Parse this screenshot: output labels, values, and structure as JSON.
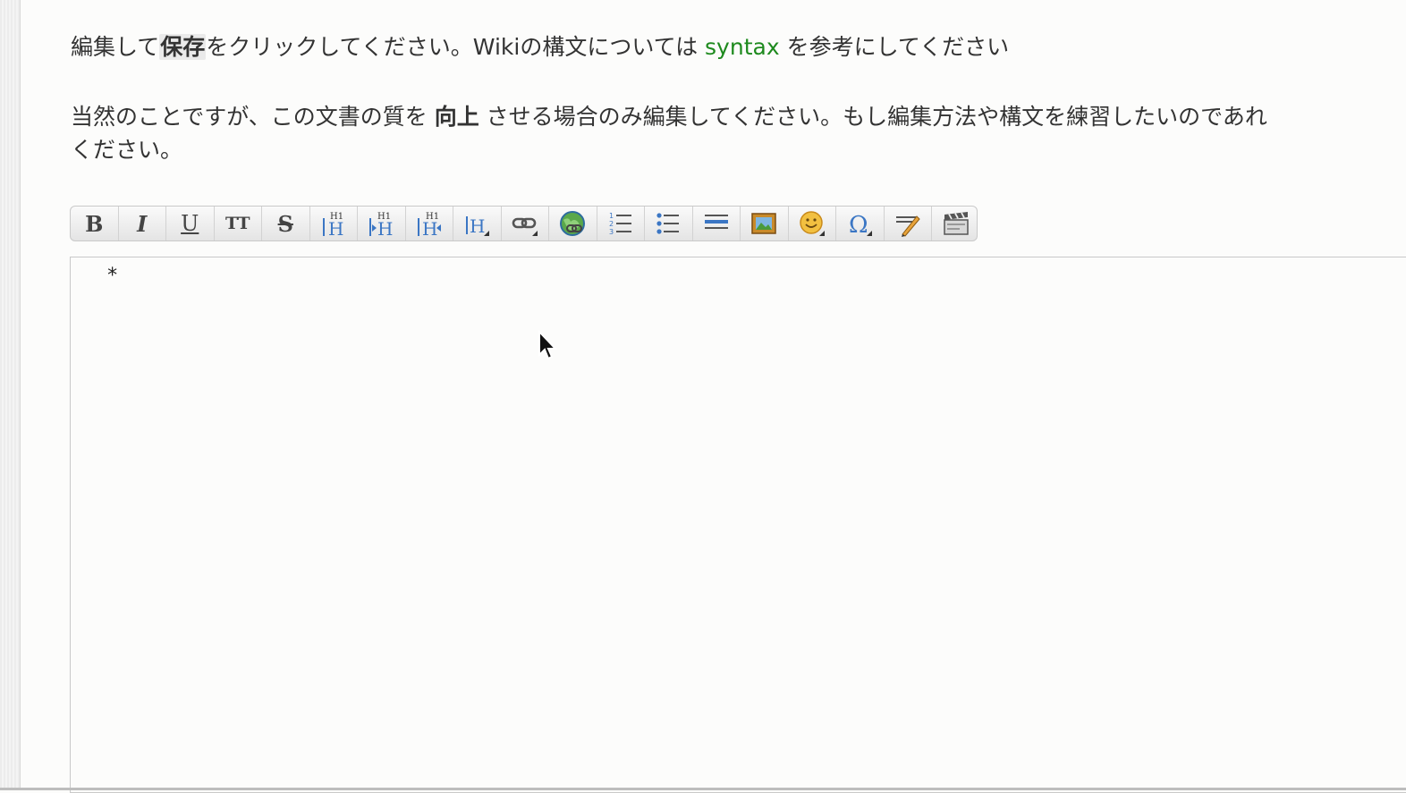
{
  "intro": {
    "before": "編集して",
    "keyword": "保存",
    "middle": "をクリックしてください。Wikiの構文については ",
    "link": "syntax",
    "after": " を参考にしてください"
  },
  "notice": {
    "before": "当然のことですが、この文書の質を ",
    "strong": "向上",
    "after": " させる場合のみ編集してください。もし編集方法や構文を練習したいのであれ",
    "line2": "ください。"
  },
  "toolbar": {
    "buttons": [
      {
        "name": "bold-button",
        "icon": "bold-icon",
        "glyph": "B"
      },
      {
        "name": "italic-button",
        "icon": "italic-icon",
        "glyph": "I"
      },
      {
        "name": "underline-button",
        "icon": "underline-icon",
        "glyph": "U"
      },
      {
        "name": "monospace-button",
        "icon": "monospace-icon",
        "glyph": "TT"
      },
      {
        "name": "strikethrough-button",
        "icon": "strikethrough-icon",
        "glyph": "S"
      },
      {
        "name": "heading-same-button",
        "icon": "heading-same-icon"
      },
      {
        "name": "heading-lower-button",
        "icon": "heading-lower-icon"
      },
      {
        "name": "heading-higher-button",
        "icon": "heading-higher-icon"
      },
      {
        "name": "heading-select-button",
        "icon": "heading-select-icon"
      },
      {
        "name": "internal-link-button",
        "icon": "link-icon"
      },
      {
        "name": "external-link-button",
        "icon": "globe-link-icon"
      },
      {
        "name": "ordered-list-button",
        "icon": "ordered-list-icon"
      },
      {
        "name": "unordered-list-button",
        "icon": "unordered-list-icon"
      },
      {
        "name": "horizontal-rule-button",
        "icon": "horizontal-rule-icon"
      },
      {
        "name": "media-button",
        "icon": "image-icon"
      },
      {
        "name": "smiley-button",
        "icon": "smiley-icon"
      },
      {
        "name": "special-chars-button",
        "icon": "omega-icon"
      },
      {
        "name": "signature-button",
        "icon": "signature-icon"
      },
      {
        "name": "clapperboard-button",
        "icon": "clapperboard-icon"
      }
    ]
  },
  "editor": {
    "content": "*"
  },
  "colors": {
    "link": "#1e8a1e",
    "heading_blue": "#3b76c4",
    "accent_orange": "#e8a33a"
  }
}
